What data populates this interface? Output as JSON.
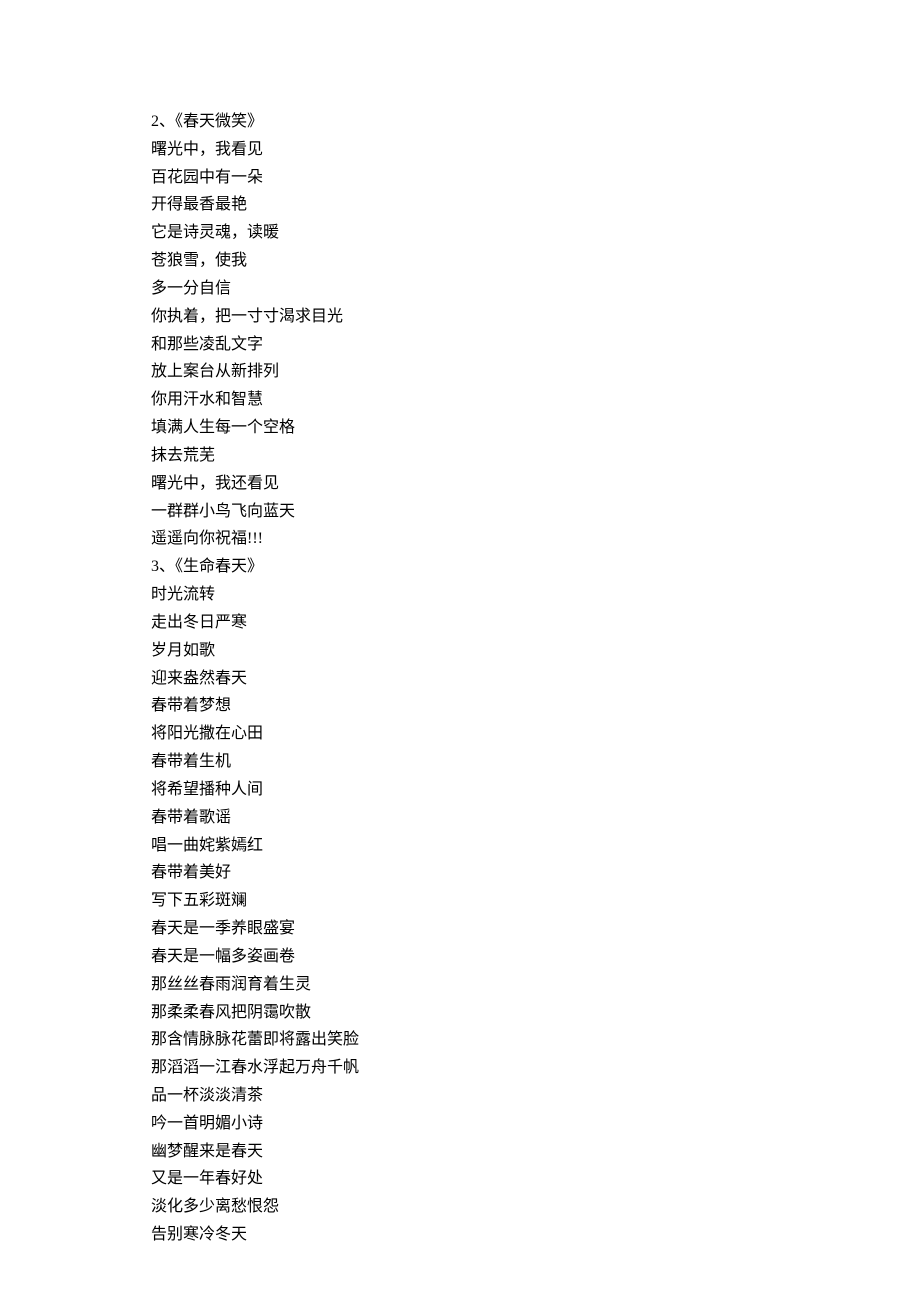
{
  "lines": [
    "2、《春天微笑》",
    "曙光中，我看见",
    "百花园中有一朵",
    "开得最香最艳",
    "它是诗灵魂，读暖",
    "苍狼雪，使我",
    "多一分自信",
    "你执着，把一寸寸渴求目光",
    "和那些凌乱文字",
    "放上案台从新排列",
    "你用汗水和智慧",
    "填满人生每一个空格",
    "抹去荒芜",
    "曙光中，我还看见",
    "一群群小鸟飞向蓝天",
    "遥遥向你祝福!!!",
    "3、《生命春天》",
    "时光流转",
    "走出冬日严寒",
    "岁月如歌",
    "迎来盎然春天",
    "春带着梦想",
    "将阳光撒在心田",
    "春带着生机",
    "将希望播种人间",
    "春带着歌谣",
    "唱一曲姹紫嫣红",
    "春带着美好",
    "写下五彩斑斓",
    "春天是一季养眼盛宴",
    "春天是一幅多姿画卷",
    "那丝丝春雨润育着生灵",
    "那柔柔春风把阴霭吹散",
    "那含情脉脉花蕾即将露出笑脸",
    "那滔滔一江春水浮起万舟千帆",
    "品一杯淡淡清茶",
    "吟一首明媚小诗",
    "幽梦醒来是春天",
    "又是一年春好处",
    "淡化多少离愁恨怨",
    "告别寒冷冬天"
  ]
}
